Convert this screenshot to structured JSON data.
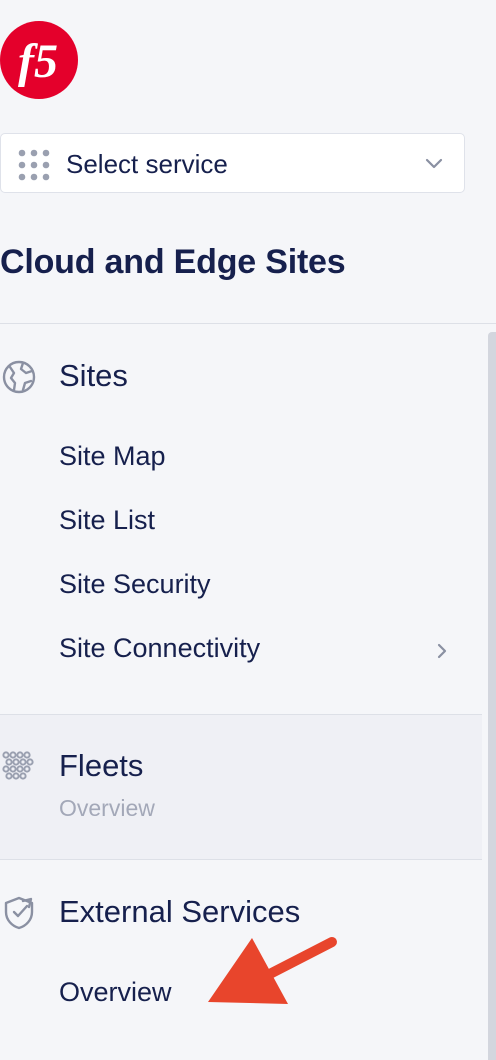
{
  "brand": {
    "logo_text": "f5",
    "logo_color": "#e4002b"
  },
  "service_selector": {
    "label": "Select service",
    "icon": "apps-grid-icon"
  },
  "section": {
    "title": "Cloud and Edge Sites"
  },
  "nav": {
    "sites": {
      "title": "Sites",
      "icon": "globe-icon",
      "items": [
        {
          "label": "Site Map"
        },
        {
          "label": "Site List"
        },
        {
          "label": "Site Security"
        },
        {
          "label": "Site Connectivity",
          "has_submenu": true
        }
      ]
    },
    "fleets": {
      "title": "Fleets",
      "icon": "fleet-icon",
      "subtitle": "Overview"
    },
    "external_services": {
      "title": "External Services",
      "icon": "shield-icon",
      "items": [
        {
          "label": "Overview"
        }
      ]
    }
  },
  "annotation": {
    "type": "arrow",
    "color": "#e8452c"
  },
  "colors": {
    "text": "#16204d",
    "muted": "#a3a8b8",
    "background": "#f5f6f9",
    "accent_red": "#e4002b"
  }
}
